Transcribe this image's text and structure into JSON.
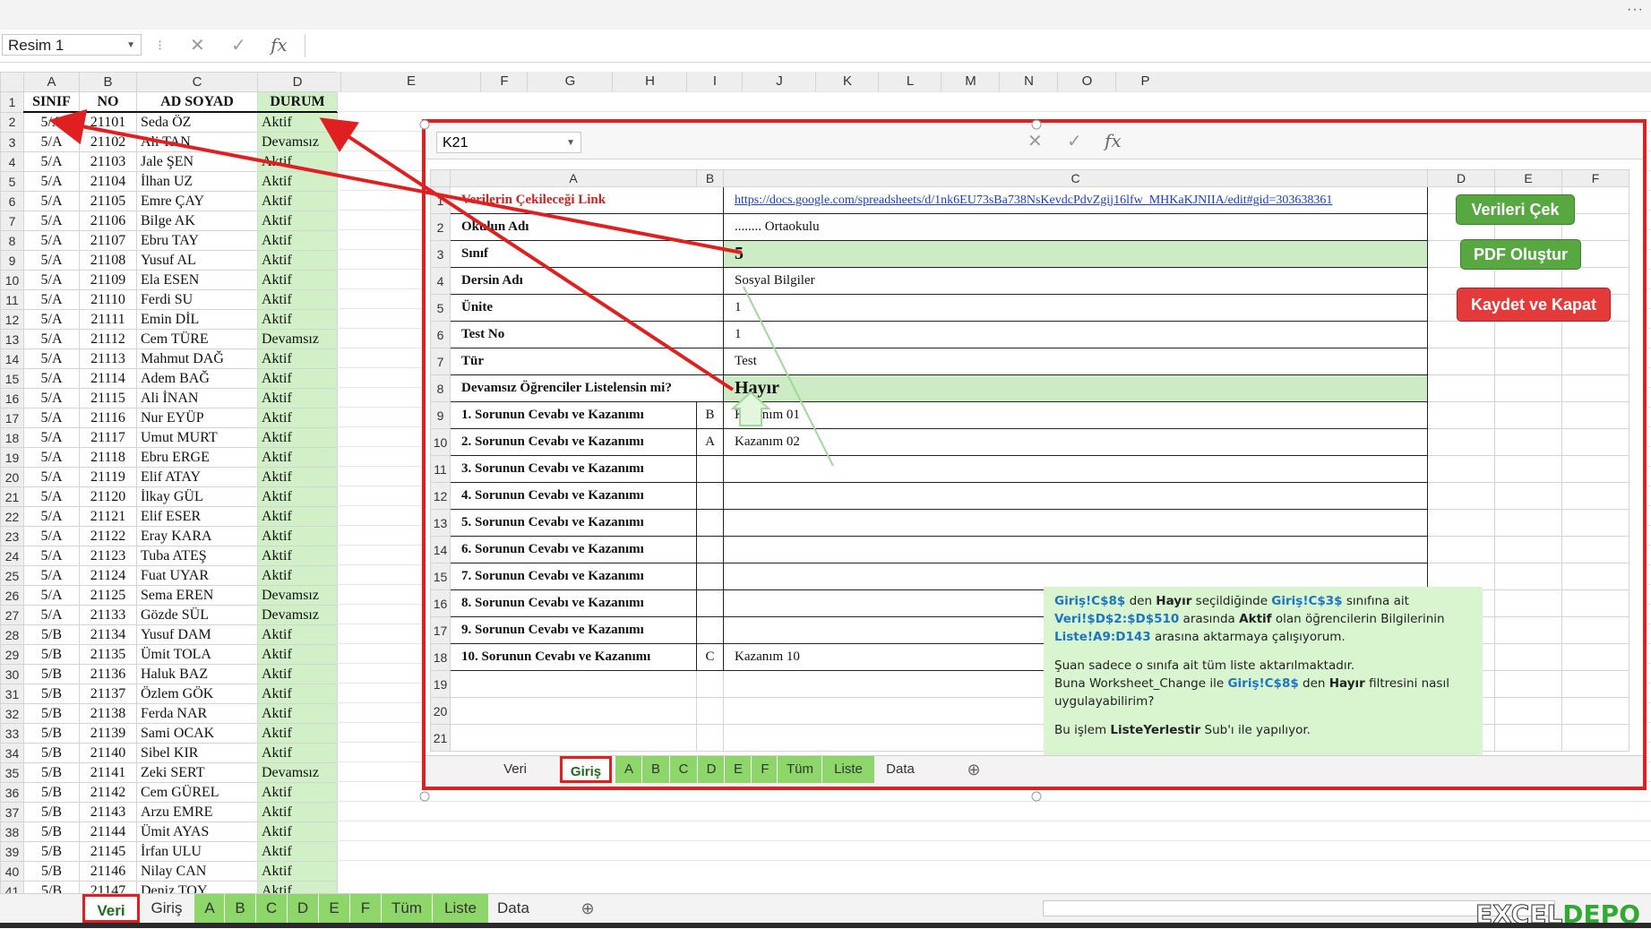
{
  "formula_bar": {
    "name_box": "Resim 1",
    "cancel_icon": "✕",
    "enter_icon": "✓",
    "fx_icon": "fx"
  },
  "left_sheet": {
    "columns": [
      "A",
      "B",
      "C",
      "D",
      "E",
      "F",
      "G",
      "H",
      "I",
      "J",
      "K",
      "L",
      "M",
      "N",
      "O",
      "P"
    ],
    "headers": {
      "sinif": "SINIF",
      "no": "NO",
      "ad_soyad": "AD SOYAD",
      "durum": "DURUM"
    },
    "rows": [
      {
        "r": "1"
      },
      {
        "r": "2",
        "a": "5/A",
        "b": "21101",
        "c": "Seda ÖZ",
        "d": "Aktif"
      },
      {
        "r": "3",
        "a": "5/A",
        "b": "21102",
        "c": "Ali TAN",
        "d": "Devamsız"
      },
      {
        "r": "4",
        "a": "5/A",
        "b": "21103",
        "c": "Jale ŞEN",
        "d": "Aktif"
      },
      {
        "r": "5",
        "a": "5/A",
        "b": "21104",
        "c": "İlhan UZ",
        "d": "Aktif"
      },
      {
        "r": "6",
        "a": "5/A",
        "b": "21105",
        "c": "Emre ÇAY",
        "d": "Aktif"
      },
      {
        "r": "7",
        "a": "5/A",
        "b": "21106",
        "c": "Bilge AK",
        "d": "Aktif"
      },
      {
        "r": "8",
        "a": "5/A",
        "b": "21107",
        "c": "Ebru TAY",
        "d": "Aktif"
      },
      {
        "r": "9",
        "a": "5/A",
        "b": "21108",
        "c": "Yusuf AL",
        "d": "Aktif"
      },
      {
        "r": "10",
        "a": "5/A",
        "b": "21109",
        "c": "Ela ESEN",
        "d": "Aktif"
      },
      {
        "r": "11",
        "a": "5/A",
        "b": "21110",
        "c": "Ferdi SU",
        "d": "Aktif"
      },
      {
        "r": "12",
        "a": "5/A",
        "b": "21111",
        "c": "Emin DİL",
        "d": "Aktif"
      },
      {
        "r": "13",
        "a": "5/A",
        "b": "21112",
        "c": "Cem TÜRE",
        "d": "Devamsız"
      },
      {
        "r": "14",
        "a": "5/A",
        "b": "21113",
        "c": "Mahmut DAĞ",
        "d": "Aktif"
      },
      {
        "r": "15",
        "a": "5/A",
        "b": "21114",
        "c": "Adem BAĞ",
        "d": "Aktif"
      },
      {
        "r": "16",
        "a": "5/A",
        "b": "21115",
        "c": "Ali İNAN",
        "d": "Aktif"
      },
      {
        "r": "17",
        "a": "5/A",
        "b": "21116",
        "c": "Nur EYÜP",
        "d": "Aktif"
      },
      {
        "r": "18",
        "a": "5/A",
        "b": "21117",
        "c": "Umut MURT",
        "d": "Aktif"
      },
      {
        "r": "19",
        "a": "5/A",
        "b": "21118",
        "c": "Ebru ERGE",
        "d": "Aktif"
      },
      {
        "r": "20",
        "a": "5/A",
        "b": "21119",
        "c": "Elif ATAY",
        "d": "Aktif"
      },
      {
        "r": "21",
        "a": "5/A",
        "b": "21120",
        "c": "İlkay GÜL",
        "d": "Aktif"
      },
      {
        "r": "22",
        "a": "5/A",
        "b": "21121",
        "c": "Elif ESER",
        "d": "Aktif"
      },
      {
        "r": "23",
        "a": "5/A",
        "b": "21122",
        "c": "Eray KARA",
        "d": "Aktif"
      },
      {
        "r": "24",
        "a": "5/A",
        "b": "21123",
        "c": "Tuba ATEŞ",
        "d": "Aktif"
      },
      {
        "r": "25",
        "a": "5/A",
        "b": "21124",
        "c": "Fuat UYAR",
        "d": "Aktif"
      },
      {
        "r": "26",
        "a": "5/A",
        "b": "21125",
        "c": "Sema EREN",
        "d": "Devamsız"
      },
      {
        "r": "27",
        "a": "5/A",
        "b": "21133",
        "c": "Gözde SÜL",
        "d": "Devamsız"
      },
      {
        "r": "28",
        "a": "5/B",
        "b": "21134",
        "c": "Yusuf DAM",
        "d": "Aktif"
      },
      {
        "r": "29",
        "a": "5/B",
        "b": "21135",
        "c": "Ümit TOLA",
        "d": "Aktif"
      },
      {
        "r": "30",
        "a": "5/B",
        "b": "21136",
        "c": "Haluk BAZ",
        "d": "Aktif"
      },
      {
        "r": "31",
        "a": "5/B",
        "b": "21137",
        "c": "Özlem GÖK",
        "d": "Aktif"
      },
      {
        "r": "32",
        "a": "5/B",
        "b": "21138",
        "c": "Ferda NAR",
        "d": "Aktif"
      },
      {
        "r": "33",
        "a": "5/B",
        "b": "21139",
        "c": "Sami OCAK",
        "d": "Aktif"
      },
      {
        "r": "34",
        "a": "5/B",
        "b": "21140",
        "c": "Sibel KIR",
        "d": "Aktif"
      },
      {
        "r": "35",
        "a": "5/B",
        "b": "21141",
        "c": "Zeki SERT",
        "d": "Devamsız"
      },
      {
        "r": "36",
        "a": "5/B",
        "b": "21142",
        "c": "Cem GÜREL",
        "d": "Aktif"
      },
      {
        "r": "37",
        "a": "5/B",
        "b": "21143",
        "c": "Arzu EMRE",
        "d": "Aktif"
      },
      {
        "r": "38",
        "a": "5/B",
        "b": "21144",
        "c": "Ümit AYAS",
        "d": "Aktif"
      },
      {
        "r": "39",
        "a": "5/B",
        "b": "21145",
        "c": "İrfan ULU",
        "d": "Aktif"
      },
      {
        "r": "40",
        "a": "5/B",
        "b": "21146",
        "c": "Nilay CAN",
        "d": "Aktif"
      },
      {
        "r": "41",
        "a": "5/B",
        "b": "21147",
        "c": "Deniz TOY",
        "d": "Aktif"
      }
    ]
  },
  "inset": {
    "name_box": "K21",
    "columns": [
      "A",
      "B",
      "C",
      "D",
      "E",
      "F"
    ],
    "rows": [
      {
        "r": "1",
        "label": "Verilerin Çekileceği Link",
        "value": "https://docs.google.com/spreadsheets/d/1nk6EU73sBa738NsKevdcPdvZgij16lfw_MHKaKJNIIA/edit#gid=303638361"
      },
      {
        "r": "2",
        "label": "Okulun Adı",
        "value": "........ Ortaokulu"
      },
      {
        "r": "3",
        "label": "Sınıf",
        "value": "5"
      },
      {
        "r": "4",
        "label": "Dersin Adı",
        "value": "Sosyal Bilgiler"
      },
      {
        "r": "5",
        "label": "Ünite",
        "value": "1"
      },
      {
        "r": "6",
        "label": "Test No",
        "value": "1"
      },
      {
        "r": "7",
        "label": "Tür",
        "value": "Test"
      },
      {
        "r": "8",
        "label": "Devamsız Öğrenciler Listelensin mi?",
        "value": "Hayır"
      },
      {
        "r": "9",
        "label": "1. Sorunun Cevabı ve Kazanımı",
        "ans": "B",
        "value": "Kazanım 01"
      },
      {
        "r": "10",
        "label": "2. Sorunun Cevabı ve Kazanımı",
        "ans": "A",
        "value": "Kazanım 02"
      },
      {
        "r": "11",
        "label": "3. Sorunun Cevabı ve Kazanımı",
        "ans": "",
        "value": ""
      },
      {
        "r": "12",
        "label": "4. Sorunun Cevabı ve Kazanımı",
        "ans": "",
        "value": ""
      },
      {
        "r": "13",
        "label": "5. Sorunun Cevabı ve Kazanımı",
        "ans": "",
        "value": ""
      },
      {
        "r": "14",
        "label": "6. Sorunun Cevabı ve Kazanımı",
        "ans": "",
        "value": ""
      },
      {
        "r": "15",
        "label": "7. Sorunun Cevabı ve Kazanımı",
        "ans": "",
        "value": ""
      },
      {
        "r": "16",
        "label": "8. Sorunun Cevabı ve Kazanımı",
        "ans": "",
        "value": ""
      },
      {
        "r": "17",
        "label": "9. Sorunun Cevabı ve Kazanımı",
        "ans": "",
        "value": ""
      },
      {
        "r": "18",
        "label": "10. Sorunun Cevabı ve Kazanımı",
        "ans": "C",
        "value": "Kazanım 10"
      },
      {
        "r": "19"
      },
      {
        "r": "20"
      },
      {
        "r": "21"
      }
    ],
    "buttons": {
      "fetch": "Verileri Çek",
      "pdf": "PDF Oluştur",
      "save_close": "Kaydet ve Kapat"
    },
    "callout": {
      "l1_ref1": "Giriş!C$8$",
      "l1_t1": " den ",
      "l1_b1": "Hayır",
      "l1_t2": " seçildiğinde ",
      "l1_ref2": "Giriş!C$3$",
      "l1_t3": " sınıfına ait",
      "l2_ref1": "Veri!$D$2:$D$510",
      "l2_t1": " arasında ",
      "l2_b1": "Aktif",
      "l2_t2": " olan öğrencilerin Bilgilerinin",
      "l3_ref1": "Liste!A9:D143",
      "l3_t1": " arasına aktarmaya çalışıyorum.",
      "l4": "Şuan sadece o sınıfa ait tüm liste aktarılmaktadır.",
      "l5_t1": "Buna Worksheet_Change ile ",
      "l5_ref1": "Giriş!C$8$",
      "l5_t2": " den ",
      "l5_b1": "Hayır",
      "l5_t3": " filtresini nasıl",
      "l6": "uygulayabilirim?",
      "l7_t1": "Bu işlem ",
      "l7_b1": "ListeYerlestir",
      "l7_t2": " Sub'ı ile yapılıyor."
    },
    "tabs": [
      "Veri",
      "Giriş",
      "A",
      "B",
      "C",
      "D",
      "E",
      "F",
      "Tüm",
      "Liste",
      "Data"
    ],
    "active_tab": "Giriş"
  },
  "sheet_tabs": [
    "Veri",
    "Giriş",
    "A",
    "B",
    "C",
    "D",
    "E",
    "F",
    "Tüm",
    "Liste",
    "Data"
  ],
  "active_sheet": "Veri",
  "logo": {
    "part1": "EXCEL",
    "part2": "DEPO"
  },
  "colors": {
    "arrow_red": "#e02020",
    "tab_green": "#8dd66a",
    "status_green": "#d2f0c8",
    "button_green": "#57a840",
    "button_red": "#e43a3a"
  }
}
